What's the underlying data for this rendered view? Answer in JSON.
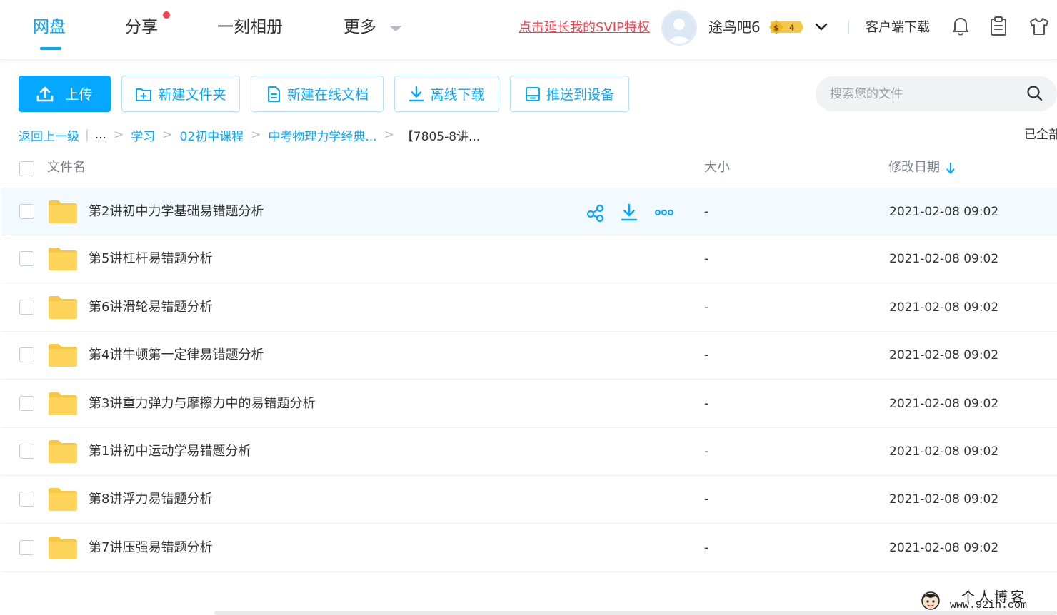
{
  "nav": {
    "tabs": [
      {
        "label": "网盘",
        "active": true
      },
      {
        "label": "分享",
        "has_dot": true
      },
      {
        "label": "一刻相册"
      },
      {
        "label": "更多"
      }
    ],
    "svip_link": "点击延长我的SVIP特权",
    "username": "途鸟吧6",
    "vip_level": "4",
    "vip_symbol": "$",
    "client_download": "客户端下载",
    "icons": [
      "bell-icon",
      "clipboard-icon",
      "shirt-icon"
    ]
  },
  "toolbar": {
    "upload": "上传",
    "new_folder": "新建文件夹",
    "new_doc": "新建在线文档",
    "offline_download": "离线下载",
    "push_device": "推送到设备"
  },
  "search": {
    "placeholder": "搜索您的文件"
  },
  "breadcrumb": {
    "back": "返回上一级",
    "ellipsis": "...",
    "items": [
      "学习",
      "02初中课程",
      "中考物理力学经典..."
    ],
    "current": "【7805-8讲...",
    "loaded_all": "已全部"
  },
  "table": {
    "headers": {
      "name": "文件名",
      "size": "大小",
      "date": "修改日期"
    },
    "sort": "date-desc",
    "rows": [
      {
        "name": "第2讲初中力学基础易错题分析",
        "size": "-",
        "date": "2021-02-08 09:02",
        "hover": true
      },
      {
        "name": "第5讲杠杆易错题分析",
        "size": "-",
        "date": "2021-02-08 09:02"
      },
      {
        "name": "第6讲滑轮易错题分析",
        "size": "-",
        "date": "2021-02-08 09:02"
      },
      {
        "name": "第4讲牛顿第一定律易错题分析",
        "size": "-",
        "date": "2021-02-08 09:02"
      },
      {
        "name": "第3讲重力弹力与摩擦力中的易错题分析",
        "size": "-",
        "date": "2021-02-08 09:02"
      },
      {
        "name": "第1讲初中运动学易错题分析",
        "size": "-",
        "date": "2021-02-08 09:02"
      },
      {
        "name": "第8讲浮力易错题分析",
        "size": "-",
        "date": "2021-02-08 09:02"
      },
      {
        "name": "第7讲压强易错题分析",
        "size": "-",
        "date": "2021-02-08 09:02"
      }
    ]
  },
  "watermark": {
    "title": "个人博客",
    "url": "www.92in.com"
  },
  "colors": {
    "accent": "#06a7ff",
    "svip": "#f5414f",
    "folder": "#ffd45b"
  }
}
